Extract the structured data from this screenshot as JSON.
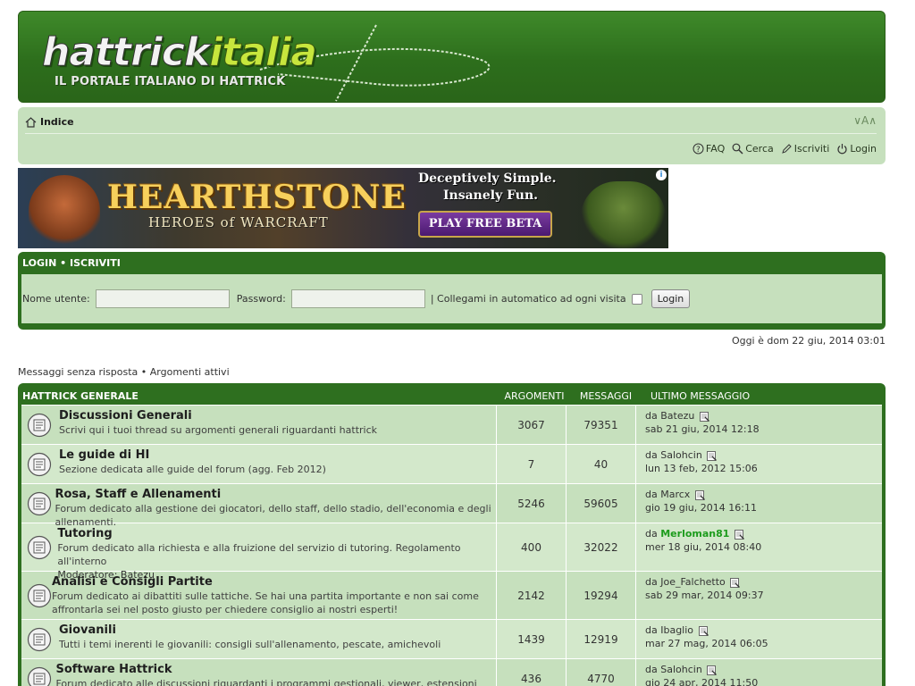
{
  "header": {
    "logo_white": "hattrick",
    "logo_green": "italia",
    "tagline": "IL PORTALE ITALIANO DI HATTRICK"
  },
  "navbar": {
    "breadcrumb": "Indice",
    "font_control": "∨A∧",
    "links": {
      "faq": "FAQ",
      "search": "Cerca",
      "register": "Iscriviti",
      "login": "Login"
    }
  },
  "banner": {
    "title": "HEARTHSTONE",
    "subtitle": "HEROES of WARCRAFT",
    "line1": "Deceptively Simple.",
    "line2": "Insanely Fun.",
    "cta": "PLAY FREE BETA",
    "ad_icon": "i"
  },
  "login": {
    "title": "LOGIN  •  ISCRIVITI",
    "username_label": "Nome utente:",
    "password_label": "Password:",
    "autologin_label": "| Collegami in automatico ad ogni visita",
    "button": "Login"
  },
  "today": "Oggi è dom 22 giu, 2014 03:01",
  "quicklinks": "Messaggi senza risposta • Argomenti attivi",
  "forum_category": {
    "title": "HATTRICK GENERALE",
    "col_topics": "ARGOMENTI",
    "col_posts": "MESSAGGI",
    "col_last": "ULTIMO MESSAGGIO"
  },
  "forums": [
    {
      "title": "Discussioni Generali",
      "desc": "Scrivi qui i tuoi thread su argomenti generali riguardanti hattrick",
      "topics": "3067",
      "posts": "79351",
      "last_by": "Batezu",
      "last_date": "sab 21 giu, 2014 12:18"
    },
    {
      "title": "Le guide di HI",
      "desc": "Sezione dedicata alle guide del forum (agg. Feb 2012)",
      "topics": "7",
      "posts": "40",
      "last_by": "Salohcin",
      "last_date": "lun 13 feb, 2012 15:06"
    },
    {
      "title": "Rosa, Staff e Allenamenti",
      "desc": "Forum dedicato alla gestione dei giocatori, dello staff, dello stadio, dell'economia e degli allenamenti.",
      "topics": "5246",
      "posts": "59605",
      "last_by": "Marcx",
      "last_date": "gio 19 giu, 2014 16:11"
    },
    {
      "title": "Tutoring",
      "desc": "Forum dedicato alla richiesta e alla fruizione del servizio di tutoring. Regolamento all'interno",
      "moderator_label": "Moderatore:",
      "moderator": "Batezu",
      "topics": "400",
      "posts": "32022",
      "last_by": "Merloman81",
      "last_date": "mer 18 giu, 2014 08:40"
    },
    {
      "title": "Analisi e Consigli Partite",
      "desc": "Forum dedicato ai dibattiti sulle tattiche. Se hai una partita importante e non sai come affrontarla sei nel posto giusto per chiedere consiglio ai nostri esperti!",
      "topics": "2142",
      "posts": "19294",
      "last_by": "Joe_Falchetto",
      "last_date": "sab 29 mar, 2014 09:37"
    },
    {
      "title": "Giovanili",
      "desc": "Tutti i temi inerenti le giovanili: consigli sull'allenamento, pescate, amichevoli",
      "topics": "1439",
      "posts": "12919",
      "last_by": "Ibaglio",
      "last_date": "mar 27 mag, 2014 06:05"
    },
    {
      "title": "Software Hattrick",
      "desc": "Forum dedicato alle discussioni riguardanti i programmi gestionali, viewer, estensioni per firefox e",
      "topics": "436",
      "posts": "4770",
      "last_by": "Salohcin",
      "last_date": "gio 24 apr, 2014 11:50"
    }
  ],
  "last_prefix": "da"
}
